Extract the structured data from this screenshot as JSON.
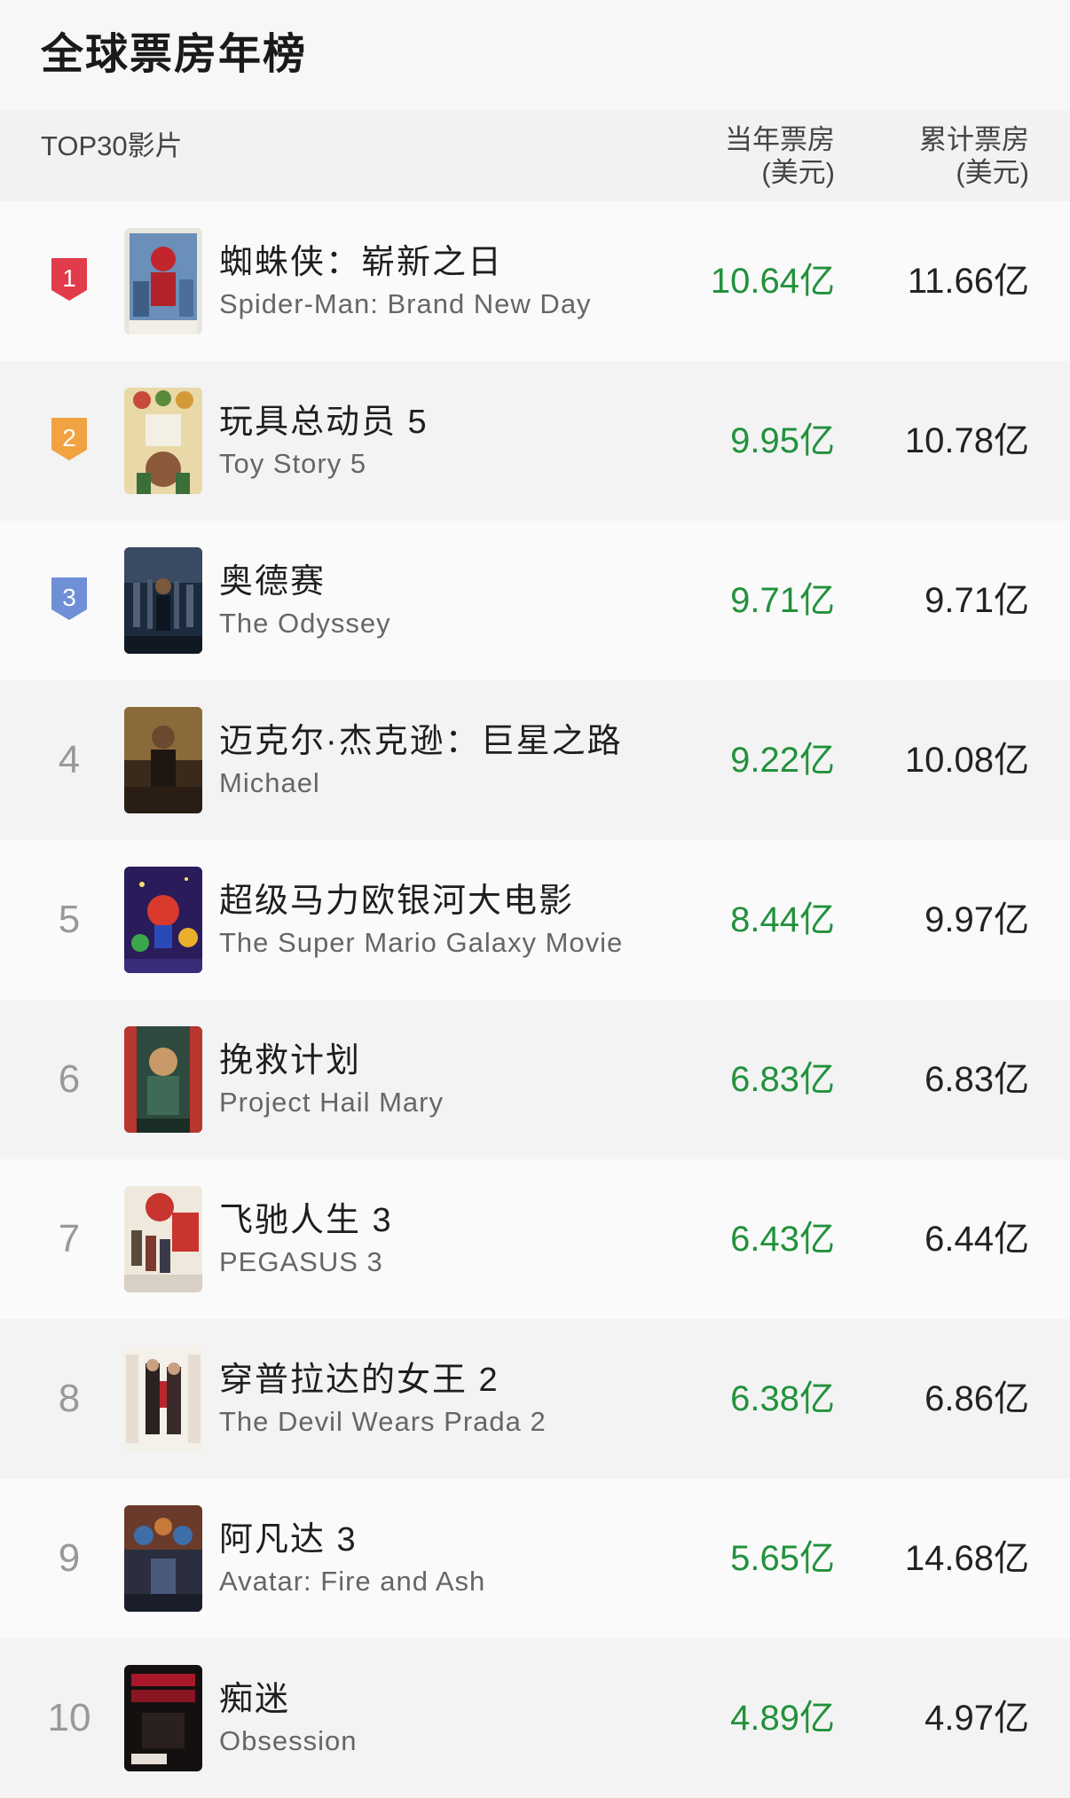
{
  "page": {
    "title": "全球票房年榜"
  },
  "header": {
    "film_col": "TOP30影片",
    "year_col_line1": "当年票房",
    "year_col_line2": "(美元)",
    "total_col_line1": "累计票房",
    "total_col_line2": "(美元)"
  },
  "colors": {
    "gross_green": "#22913c",
    "gold_badge": "#f0a340",
    "red_badge": "#e23b4a",
    "blue_badge": "#6f8fd6"
  },
  "films": [
    {
      "rank": "1",
      "cn": "蜘蛛侠：崭新之日",
      "en": "Spider-Man: Brand New Day",
      "year_gross": "10.64亿",
      "total_gross": "11.66亿",
      "badge": "red-badge-icon",
      "poster": "spider-man-poster"
    },
    {
      "rank": "2",
      "cn": "玩具总动员 5",
      "en": "Toy Story 5",
      "year_gross": "9.95亿",
      "total_gross": "10.78亿",
      "badge": "gold-badge-icon",
      "poster": "toy-story-poster"
    },
    {
      "rank": "3",
      "cn": "奥德赛",
      "en": "The Odyssey",
      "year_gross": "9.71亿",
      "total_gross": "9.71亿",
      "badge": "blue-badge-icon",
      "poster": "odyssey-poster"
    },
    {
      "rank": "4",
      "cn": "迈克尔·杰克逊：巨星之路",
      "en": "Michael",
      "year_gross": "9.22亿",
      "total_gross": "10.08亿",
      "poster": "michael-poster"
    },
    {
      "rank": "5",
      "cn": "超级马力欧银河大电影",
      "en": "The Super Mario Galaxy Movie",
      "year_gross": "8.44亿",
      "total_gross": "9.97亿",
      "poster": "mario-poster"
    },
    {
      "rank": "6",
      "cn": "挽救计划",
      "en": "Project Hail Mary",
      "year_gross": "6.83亿",
      "total_gross": "6.83亿",
      "poster": "hail-mary-poster"
    },
    {
      "rank": "7",
      "cn": "飞驰人生 3",
      "en": "PEGASUS 3",
      "year_gross": "6.43亿",
      "total_gross": "6.44亿",
      "poster": "pegasus-poster"
    },
    {
      "rank": "8",
      "cn": "穿普拉达的女王 2",
      "en": "The Devil Wears Prada 2",
      "year_gross": "6.38亿",
      "total_gross": "6.86亿",
      "poster": "prada-poster"
    },
    {
      "rank": "9",
      "cn": "阿凡达 3",
      "en": "Avatar: Fire and Ash",
      "year_gross": "5.65亿",
      "total_gross": "14.68亿",
      "poster": "avatar-poster"
    },
    {
      "rank": "10",
      "cn": "痴迷",
      "en": "Obsession",
      "year_gross": "4.89亿",
      "total_gross": "4.97亿",
      "poster": "obsession-poster"
    }
  ]
}
